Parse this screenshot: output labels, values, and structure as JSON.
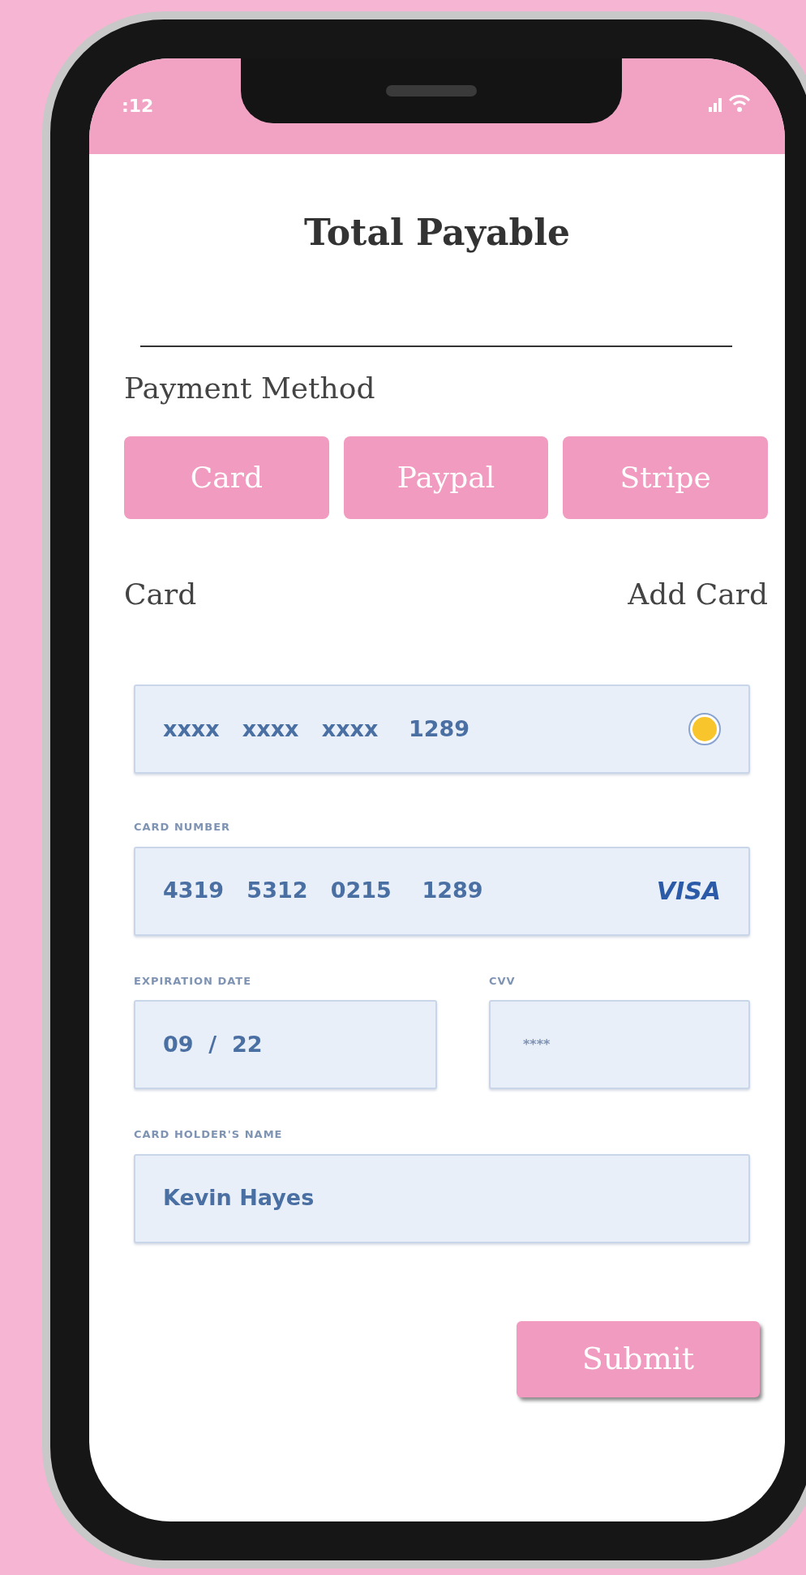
{
  "status_bar": {
    "time": ":12"
  },
  "title": "Total Payable",
  "payment_method": {
    "label": "Payment Method",
    "options": [
      {
        "label": "Card"
      },
      {
        "label": "Paypal"
      },
      {
        "label": "Stripe"
      }
    ]
  },
  "card_section": {
    "label": "Card",
    "action": "Add Card"
  },
  "saved_card": {
    "number": "xxxx   xxxx   xxxx    1289",
    "selected": true
  },
  "card_number": {
    "label": "CARD NUMBER",
    "value": "4319   5312   0215    1289",
    "brand": "VISA"
  },
  "expiration": {
    "label": "EXPIRATION DATE",
    "value": "09  /  22"
  },
  "cvv": {
    "label": "CVV",
    "value": "****"
  },
  "holder": {
    "label": "CARD HOLDER'S NAME",
    "value": "Kevin Hayes"
  },
  "submit": "Submit"
}
